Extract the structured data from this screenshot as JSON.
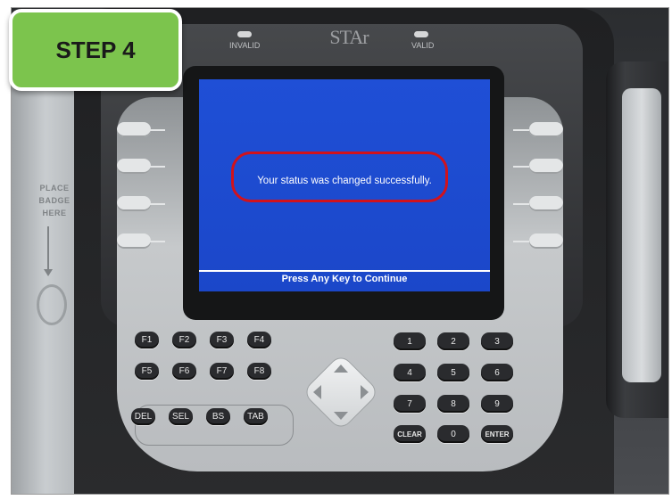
{
  "step_badge": {
    "label": "STEP 4"
  },
  "device": {
    "logo": "STAr",
    "leds": {
      "invalid": "INVALID",
      "valid": "VALID"
    },
    "badge_area": {
      "text": "PLACE\nBADGE\nHERE"
    }
  },
  "screen": {
    "message": "Your status was changed successfully.",
    "footer": "Press Any Key to Continue"
  },
  "keypad": {
    "function_keys_row1": [
      "F1",
      "F2",
      "F3",
      "F4"
    ],
    "function_keys_row2": [
      "F5",
      "F6",
      "F7",
      "F8"
    ],
    "edit_keys": [
      "DEL",
      "SEL",
      "BS",
      "TAB"
    ],
    "numbers_row1": [
      "1",
      "2",
      "3"
    ],
    "numbers_row2": [
      "4",
      "5",
      "6"
    ],
    "numbers_row3": [
      "7",
      "8",
      "9"
    ],
    "bottom_row": [
      "CLEAR",
      "0",
      "ENTER"
    ]
  },
  "colors": {
    "screen_blue": "#1f4fd6",
    "highlight_red": "#d1121c",
    "step_green": "#7cc44d"
  }
}
